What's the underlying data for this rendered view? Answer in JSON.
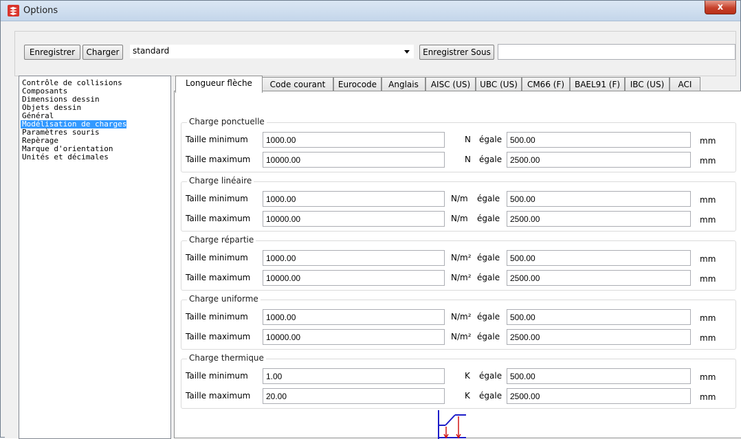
{
  "window": {
    "title": "Options",
    "close_glyph": "x",
    "app_icon": "options-app-icon"
  },
  "toolbar": {
    "save_label": "Enregistrer",
    "load_label": "Charger",
    "preset_value": "standard",
    "save_as_label": "Enregistrer Sous",
    "save_as_name": ""
  },
  "categories": [
    {
      "label": "Contrôle de collisions"
    },
    {
      "label": "Composants"
    },
    {
      "label": "Dimensions dessin"
    },
    {
      "label": "Objets dessin"
    },
    {
      "label": "Général"
    },
    {
      "label": "Modélisation de charges",
      "selected": true
    },
    {
      "label": "Paramètres souris"
    },
    {
      "label": "Repèrage"
    },
    {
      "label": "Marque d'orientation"
    },
    {
      "label": "Unités et décimales"
    }
  ],
  "tabs": [
    {
      "label": "Longueur flèche",
      "active": true
    },
    {
      "label": "Code courant"
    },
    {
      "label": "Eurocode"
    },
    {
      "label": "Anglais"
    },
    {
      "label": "AISC (US)"
    },
    {
      "label": "UBC (US)"
    },
    {
      "label": "CM66 (F)"
    },
    {
      "label": "BAEL91 (F)"
    },
    {
      "label": "IBC (US)"
    },
    {
      "label": "ACI"
    }
  ],
  "labels": {
    "min": "Taille minimum",
    "max": "Taille maximum",
    "equals": "égale",
    "length_unit": "mm"
  },
  "groups": [
    {
      "title": "Charge ponctuelle",
      "unit": "N",
      "min": {
        "value": "1000.00",
        "equals": "500.00"
      },
      "max": {
        "value": "10000.00",
        "equals": "2500.00"
      }
    },
    {
      "title": "Charge linéaire",
      "unit": "N/m",
      "min": {
        "value": "1000.00",
        "equals": "500.00"
      },
      "max": {
        "value": "10000.00",
        "equals": "2500.00"
      }
    },
    {
      "title": "Charge répartie",
      "unit": "N/m²",
      "min": {
        "value": "1000.00",
        "equals": "500.00"
      },
      "max": {
        "value": "10000.00",
        "equals": "2500.00"
      }
    },
    {
      "title": "Charge uniforme",
      "unit": "N/m²",
      "min": {
        "value": "1000.00",
        "equals": "500.00"
      },
      "max": {
        "value": "10000.00",
        "equals": "2500.00"
      }
    },
    {
      "title": "Charge thermique",
      "unit": "K",
      "min": {
        "value": "1.00",
        "equals": "500.00"
      },
      "max": {
        "value": "20.00",
        "equals": "2500.00"
      }
    }
  ],
  "colors": {
    "selection": "#3399ff",
    "diagram_line": "#1c1cc8",
    "diagram_arrow": "#d01414"
  }
}
